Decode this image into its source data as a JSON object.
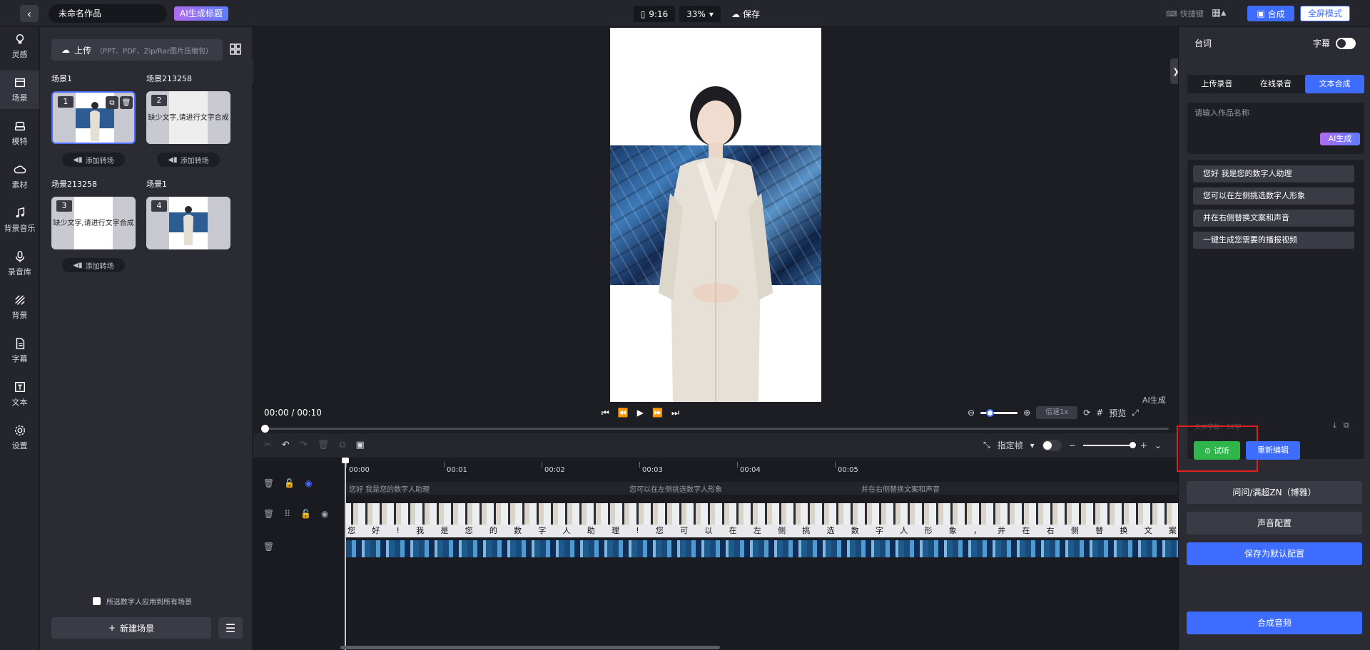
{
  "topbar": {
    "title": "未命名作品",
    "ai_title": "AI生成标题",
    "ratio": "9:16",
    "zoom": "33%",
    "save": "保存",
    "shortcuts": "快捷键",
    "synthesize": "合成",
    "fullscreen": "全屏模式"
  },
  "nav": [
    {
      "label": "灵感",
      "icon": "bulb-icon"
    },
    {
      "label": "场景",
      "icon": "scene-icon"
    },
    {
      "label": "模特",
      "icon": "model-icon"
    },
    {
      "label": "素材",
      "icon": "cloud-icon"
    },
    {
      "label": "背景音乐",
      "icon": "music-icon"
    },
    {
      "label": "录音库",
      "icon": "mic-icon"
    },
    {
      "label": "背景",
      "icon": "background-icon"
    },
    {
      "label": "字幕",
      "icon": "subtitle-icon"
    },
    {
      "label": "文本",
      "icon": "text-icon"
    },
    {
      "label": "设置",
      "icon": "settings-icon"
    }
  ],
  "scenes": {
    "upload_label": "上传",
    "upload_hint": "（PPT、PDF、Zip/Rar图片压缩包）",
    "items": [
      {
        "name": "场景1",
        "num": "1"
      },
      {
        "name": "场景213258",
        "num": "2",
        "note": "缺少文字,请进行文字合成"
      },
      {
        "name": "场景213258",
        "num": "3",
        "note": "缺少文字,请进行文字合成"
      },
      {
        "name": "场景1",
        "num": "4"
      }
    ],
    "add_transition": "添加转场",
    "apply_all": "所选数字人应用到所有场景",
    "new_scene": "新建场景"
  },
  "preview": {
    "time": "00:00 / 00:10",
    "ai_watermark": "AI生成",
    "speed": "倍速1x",
    "preview_label": "预览"
  },
  "timeline": {
    "frame_label": "指定帧",
    "ticks": [
      "00:00",
      "00:01",
      "00:02",
      "00:03",
      "00:04",
      "00:05"
    ],
    "text_segments": [
      "您好 我是您的数字人助理",
      "您可以在左侧挑选数字人形象",
      "并在右侧替换文案和声音"
    ],
    "chars": [
      "您",
      "好",
      "!",
      "我",
      "是",
      "您",
      "的",
      "数",
      "字",
      "人",
      "助",
      "理",
      "!",
      "您",
      "可",
      "以",
      "在",
      "左",
      "侧",
      "挑",
      "选",
      "数",
      "字",
      "人",
      "形",
      "象",
      "，",
      "并",
      "在",
      "右",
      "侧",
      "替",
      "换",
      "文",
      "案"
    ]
  },
  "right": {
    "title": "台词",
    "subtitle_label": "字幕",
    "tabs": [
      "上传录音",
      "在线录音",
      "文本合成"
    ],
    "name_placeholder": "请输入作品名称",
    "ai_generate": "AI生成",
    "lines": [
      "您好 我是您的数字人助理",
      "您可以在左侧挑选数字人形象",
      "并在右侧替换文案和声音",
      "一键生成您需要的播报视频"
    ],
    "char_count": "文本字数：52字",
    "listen": "试听",
    "reedit": "重新编辑",
    "voice": "问问/满超ZN（博雅）",
    "voice_config": "声音配置",
    "save_default": "保存为默认配置",
    "synth_audio": "合成音频"
  }
}
